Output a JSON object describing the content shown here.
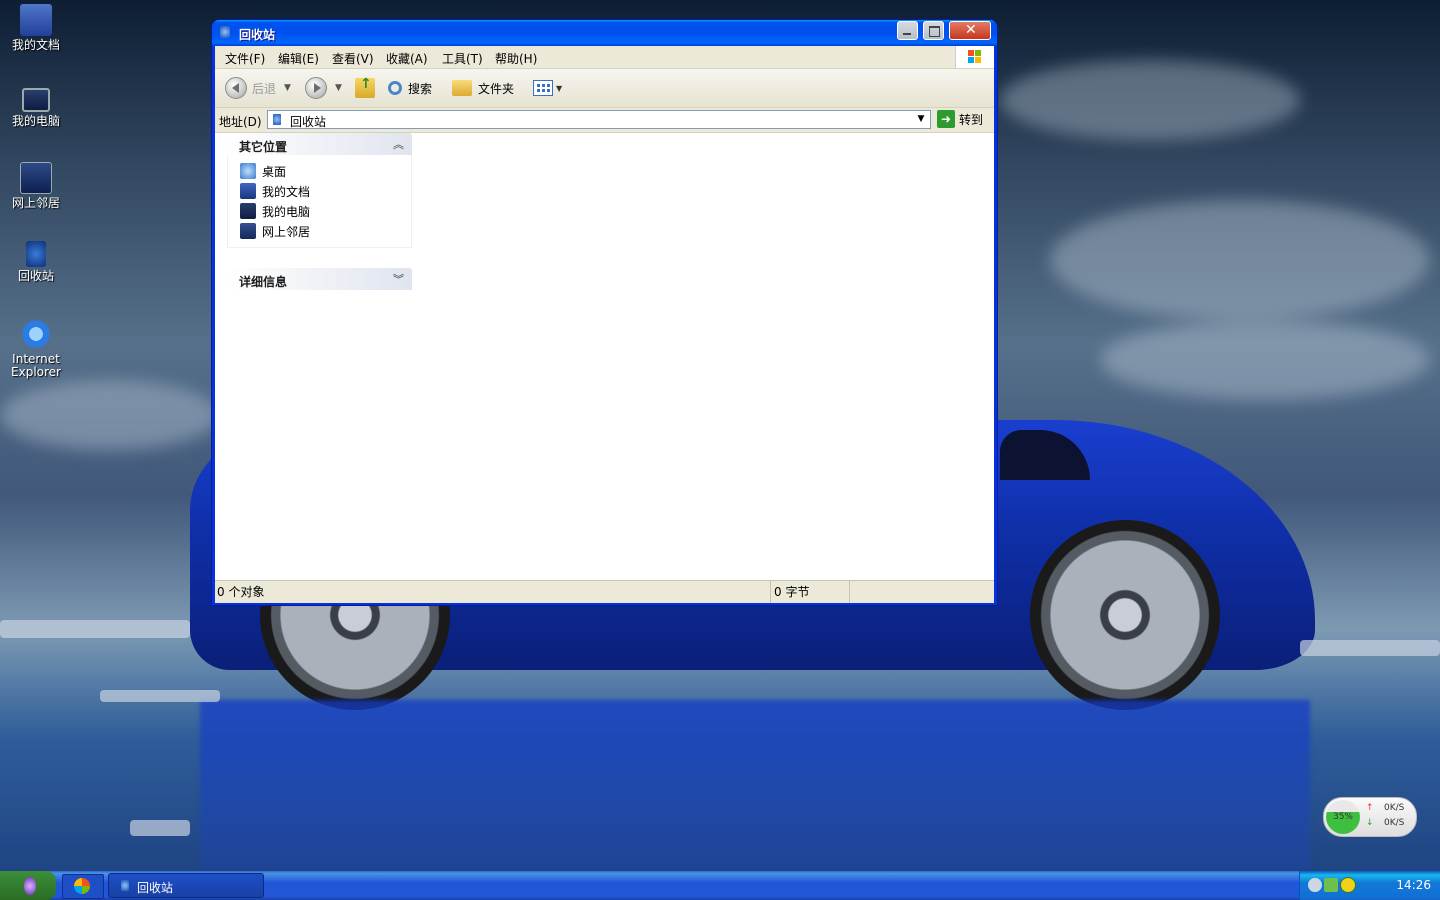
{
  "desktop": {
    "icons": [
      {
        "label": "我的文档",
        "icon": "my-documents-icon"
      },
      {
        "label": "我的电脑",
        "icon": "my-computer-icon"
      },
      {
        "label": "网上邻居",
        "icon": "network-places-icon"
      },
      {
        "label": "回收站",
        "icon": "recycle-bin-icon"
      },
      {
        "label_line1": "Internet",
        "label_line2": "Explorer",
        "icon": "internet-explorer-icon"
      }
    ]
  },
  "window": {
    "title": "回收站",
    "menu": [
      "文件(F)",
      "编辑(E)",
      "查看(V)",
      "收藏(A)",
      "工具(T)",
      "帮助(H)"
    ],
    "toolbar": {
      "back_label": "后退",
      "search_label": "搜索",
      "folders_label": "文件夹"
    },
    "address": {
      "label": "地址(D)",
      "value": "回收站",
      "go_label": "转到"
    },
    "other_places": {
      "title": "其它位置",
      "items": [
        "桌面",
        "我的文档",
        "我的电脑",
        "网上邻居"
      ]
    },
    "details": {
      "title": "详细信息"
    },
    "status": {
      "objects": "0 个对象",
      "size": "0 字节"
    }
  },
  "taskbar": {
    "task_label": "回收站",
    "clock": "14:26"
  },
  "net_widget": {
    "percent": "35%",
    "up": "0K/S",
    "down": "0K/S"
  },
  "colors": {
    "titlebar": "#0054e3",
    "taskbar": "#2157d7",
    "window_bg": "#ece9d8"
  }
}
